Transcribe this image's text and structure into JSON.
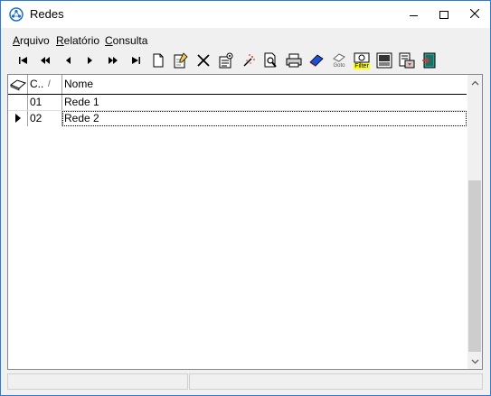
{
  "window": {
    "title": "Redes",
    "controls": [
      "minimize-icon",
      "maximize-icon",
      "close-icon"
    ]
  },
  "menu": {
    "items": [
      {
        "label": "Arquivo",
        "accel": "A",
        "rest": "rquivo"
      },
      {
        "label": "Relatório",
        "accel": "R",
        "rest": "elatório"
      },
      {
        "label": "Consulta",
        "accel": "C",
        "rest": "onsulta"
      }
    ]
  },
  "toolbar": {
    "buttons": [
      "first-record-icon",
      "previous-page-icon",
      "previous-record-icon",
      "next-record-icon",
      "next-page-icon",
      "last-record-icon",
      "new-record-icon",
      "edit-record-icon",
      "delete-record-icon",
      "properties-icon",
      "wizard-icon",
      "preview-icon",
      "print-icon",
      "bookmark-icon",
      "goto-icon",
      "filter-icon",
      "report-icon",
      "export-icon",
      "exit-icon"
    ],
    "goto_label": "Goto",
    "filter_label": "Filter"
  },
  "grid": {
    "columns": [
      {
        "label": "C..",
        "sort": "/"
      },
      {
        "label": "Nome"
      }
    ],
    "rows": [
      {
        "code": "01",
        "name": "Rede 1",
        "current": false
      },
      {
        "code": "02",
        "name": "Rede 2",
        "current": true
      }
    ]
  },
  "statusbar": {
    "panels": [
      "",
      ""
    ]
  },
  "colors": {
    "window_border": "#2b7cd3",
    "grid_border": "#828790",
    "scroll_thumb": "#cdcdcd",
    "filter_yellow": "#ffff00"
  }
}
